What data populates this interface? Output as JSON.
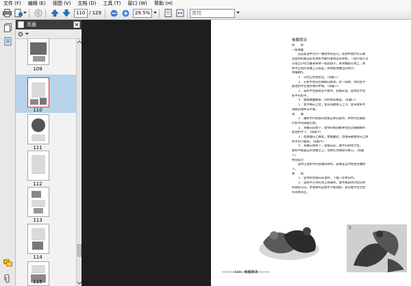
{
  "menu": [
    "文件 (F)",
    "编辑 (E)",
    "视图 (V)",
    "文档 (D)",
    "工具 (T)",
    "窗口 (W)",
    "帮助 (H)"
  ],
  "toolbar": {
    "current_page": "110",
    "total_pages": "/ 129",
    "zoom": "29.5%",
    "search_placeholder": "查找"
  },
  "panel": {
    "title": "页面",
    "thumbnails": [
      {
        "label": "109",
        "selected": false
      },
      {
        "label": "110",
        "selected": true
      },
      {
        "label": "111",
        "selected": false
      },
      {
        "label": "112",
        "selected": false
      },
      {
        "label": "113",
        "selected": false
      },
      {
        "label": "114",
        "selected": false
      },
      {
        "label": "115",
        "selected": false
      }
    ]
  },
  "document": {
    "title": "後腿摔法",
    "lines": [
      "摔　　摔",
      "一般要義",
      "　　這是柔道中另外一種實用的技巧。從剛中我們可以看",
      "出使用的要訣是利用對手動作要領及其特色。一個小個子可",
      "以借自小的力量來摔倒一個高個子，將身體貼向地上，將",
      "對手自身的身體上方提起，摔倒使他擲出的摔力。",
      "準備動作",
      "　　１．以右自然姿勢立。（如圖１）",
      "　　２．先對手使其左腳略向後退，從一開始，你的左手",
      "握住對手左袖外側的中間。（如圖２）",
      "　　３．當對手左腳站定平衡時，右腳前進，並用右手拉",
      "對手的右手。",
      "　　４．雙腳微曲體會，同時將其推進。（如圖３）",
      "　　５．雙手略向上拉，使其身體重心上浮，並帶使對手",
      "身體前傾失去平衡。",
      "攻　　擊",
      "　　１．讓對手的右腳向右腳正要前進時，將你的左腳貼",
      "於對手的兩腳之間。",
      "　　２．身體向前傾下，使你的臀部推舉住左足踝關節時",
      "提住對手下。（如圖４）",
      "　　３．右腳盤向上踢起，雙腿曲起，右腳靠著腰部向上將",
      "對手的小腿提。（如圖４）",
      "　　４．身體向後摔下，右腳向前，雙手同時用力拉，",
      "使對手被逼自的身體之上，而倒在你頭部的後方。（如圖",
      "５）",
      "特別提示",
      "　　當你已使對手的身體前傾時，就應當自然地使身體倒",
      "下。",
      "要　　點",
      "　　１．當你的左腳向前進時，下盤一定要向內。",
      "　　２．當對手在你的身上剛著時，雙手應當用力拉向你",
      "的頭部方向，更重要的是雙手不能放鬆，直到雙手拉至你",
      "的耳側為止。"
    ],
    "footer": "110．後腿摔法",
    "photo_label": "5"
  }
}
